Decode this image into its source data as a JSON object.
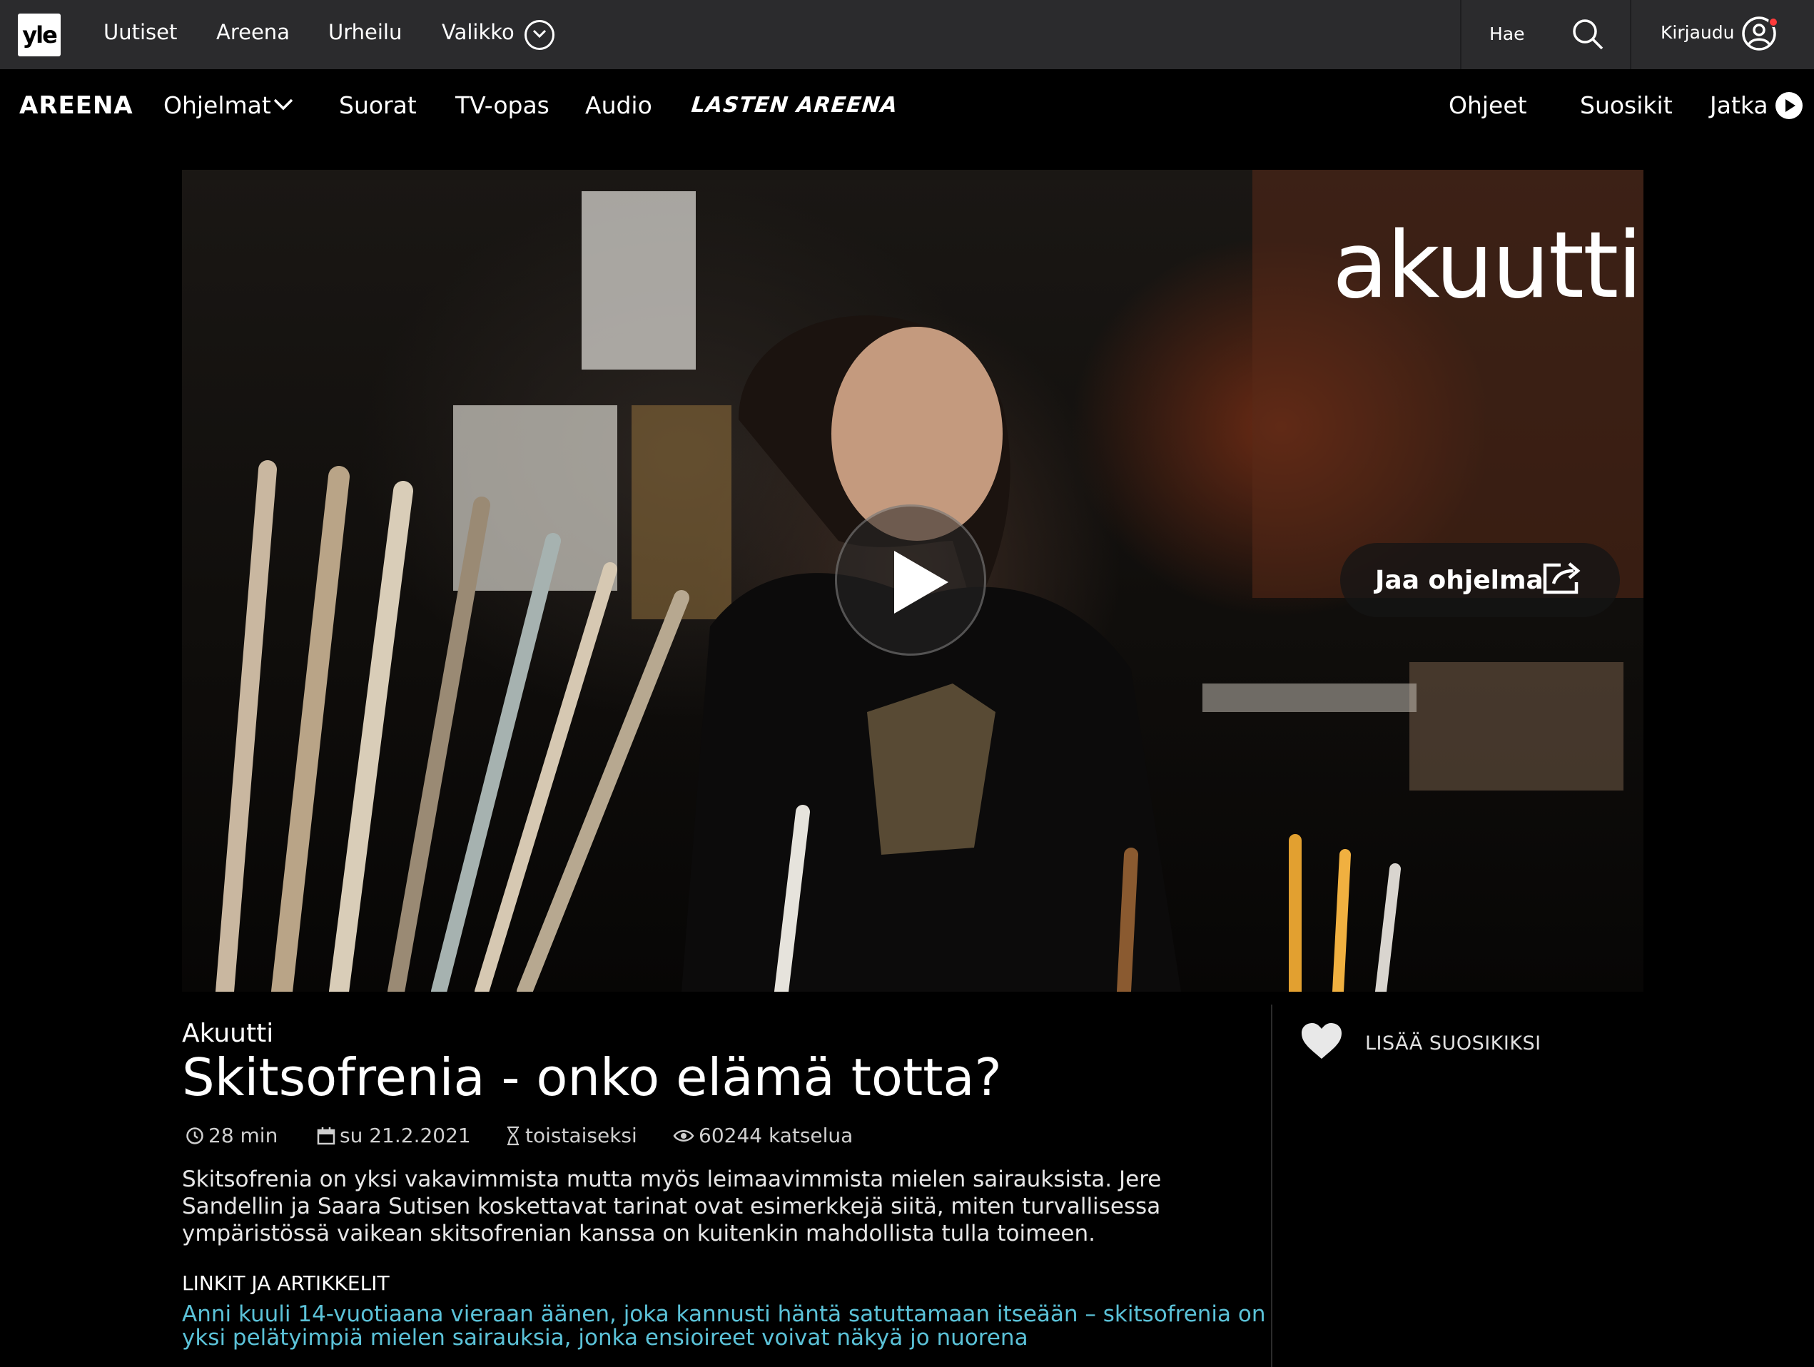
{
  "topbar": {
    "logo": "yle",
    "nav": [
      "Uutiset",
      "Areena",
      "Urheilu",
      "Valikko"
    ],
    "search_label": "Hae",
    "login_label": "Kirjaudu"
  },
  "areena_nav": {
    "logo": "AREENA",
    "items": [
      "Ohjelmat",
      "Suorat",
      "TV-opas",
      "Audio"
    ],
    "kids": "LASTEN AREENA",
    "right": [
      "Ohjeet",
      "Suosikit",
      "Jatka"
    ]
  },
  "hero": {
    "brand": "akuutti",
    "share_label": "Jaa ohjelma"
  },
  "program": {
    "series": "Akuutti",
    "title": "Skitsofrenia - onko elämä totta?",
    "duration": "28 min",
    "date": "su 21.2.2021",
    "availability": "toistaiseksi",
    "views": "60244 katselua",
    "description": "Skitsofrenia on yksi vakavimmista mutta myös leimaavimmista mielen sairauksista. Jere Sandellin ja Saara Sutisen koskettavat tarinat ovat esimerkkejä siitä, miten turvallisessa ympäristössä vaikean skitsofrenian kanssa on kuitenkin mahdollista tulla toimeen.",
    "links_heading": "LINKIT JA ARTIKKELIT",
    "link_text": "Anni kuuli 14-vuotiaana vieraan äänen, joka kannusti häntä satuttamaan itseään – skitsofrenia on yksi pelätyimpiä mielen sairauksia, jonka ensioireet voivat näkyä jo nuorena"
  },
  "favorite": {
    "label": "LISÄÄ SUOSIKIKSI"
  },
  "colors": {
    "topbar": "#2b2b2d",
    "link": "#5bc2d8",
    "background": "#000000"
  }
}
